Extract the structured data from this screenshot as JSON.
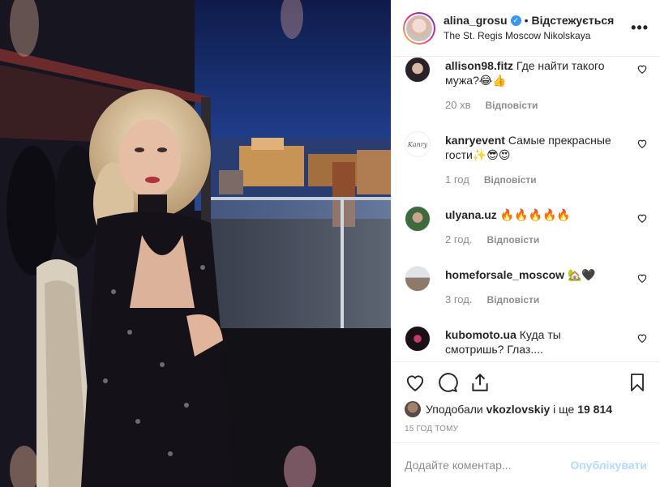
{
  "post": {
    "username": "alina_grosu",
    "follow_status": "Відстежується",
    "location": "The St. Regis Moscow Nikolskaya",
    "more_icon": "more-options-icon"
  },
  "comments": [
    {
      "user": "allison98.fitz",
      "text": "Где найти такого мужа?😂👍",
      "time": "20 хв",
      "reply": "Відповісти"
    },
    {
      "user": "kanryevent",
      "text": "Самые прекрасные гости✨😎😍",
      "time": "1 год",
      "reply": "Відповісти",
      "avatar_text": "Kanry"
    },
    {
      "user": "ulyana.uz",
      "text": "🔥🔥🔥🔥🔥",
      "time": "2 год.",
      "reply": "Відповісти"
    },
    {
      "user": "homeforsale_moscow",
      "text": "🏡🖤",
      "time": "3 год.",
      "reply": "Відповісти"
    },
    {
      "user": "kubomoto.ua",
      "text": "Куда ты смотришь? Глаз....",
      "time": "",
      "reply": ""
    }
  ],
  "actions": {
    "liked_by_prefix": "Уподобали",
    "liked_by_user": "vkozlovskiy",
    "liked_by_conj": "і ще",
    "likes_count": "19 814",
    "timestamp": "15 ГОД ТОМУ"
  },
  "composer": {
    "placeholder": "Додайте коментар...",
    "publish_label": "Опублікувати"
  },
  "colors": {
    "brand_blue": "#3897f0",
    "publish_disabled": "#b3dbff",
    "muted_text": "#8e8e8e"
  }
}
